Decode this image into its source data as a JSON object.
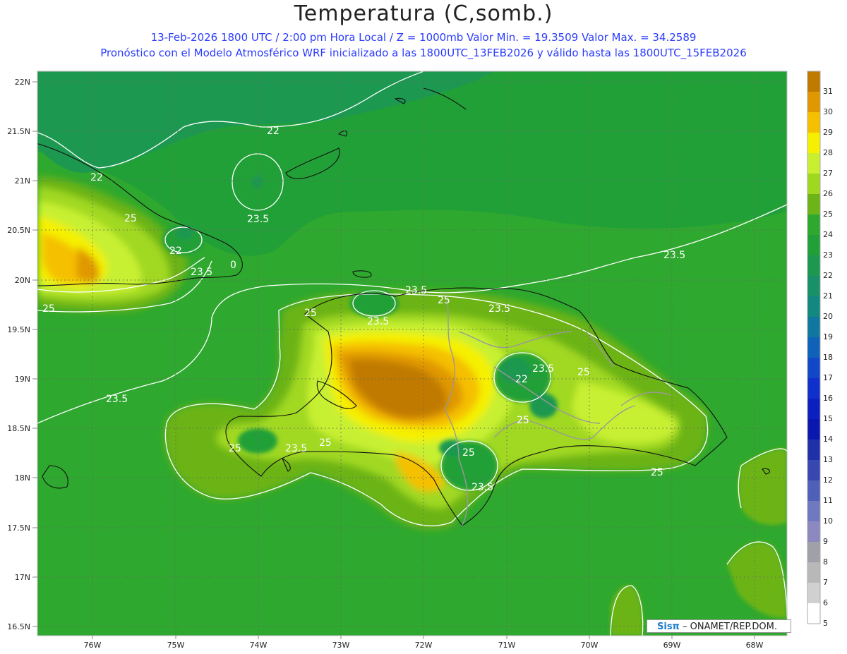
{
  "title": "Temperatura (C,somb.)",
  "subtitle_line1": "13-Feb-2026  1800 UTC / 2:00 pm Hora Local / Z = 1000mb   Valor Min. = 19.3509  Valor Max. = 34.2589",
  "subtitle_line2": "Pronóstico con el Modelo Atmosférico WRF inicializado a las 1800UTC_13FEB2026 y válido hasta las  1800UTC_15FEB2026",
  "lat_labels": [
    "22N",
    "21.5N",
    "21N",
    "20.5N",
    "20N",
    "19.5N",
    "19N",
    "18.5N",
    "18N",
    "17.5N",
    "17N",
    "16.5N"
  ],
  "lon_labels": [
    "76W",
    "75W",
    "74W",
    "73W",
    "72W",
    "71W",
    "70W",
    "69W",
    "68W"
  ],
  "contour_labels": [
    "22",
    "22",
    "22",
    "23.5",
    "23.5",
    "23.5",
    "23.5",
    "23.5",
    "23.5",
    "23.5",
    "23.5",
    "25",
    "25",
    "25",
    "25",
    "25",
    "25",
    "25",
    "25",
    "25",
    "25",
    "0"
  ],
  "colorbar": {
    "labels": [
      "31",
      "30",
      "29",
      "28",
      "27",
      "26",
      "25",
      "24",
      "23",
      "22",
      "21",
      "20",
      "19",
      "18",
      "17",
      "16",
      "15",
      "14",
      "13",
      "12",
      "11",
      "10",
      "9",
      "8",
      "7",
      "6",
      "5"
    ],
    "colors": [
      "#c07a00",
      "#e09800",
      "#f5c000",
      "#f5f000",
      "#c8f030",
      "#a0d820",
      "#6cb418",
      "#2ea82e",
      "#22a038",
      "#1c9850",
      "#189068",
      "#128880",
      "#1078a0",
      "#1062b8",
      "#1048c8",
      "#1030cc",
      "#0c20c0",
      "#0a18b0",
      "#2030a8",
      "#3848b0",
      "#5060b8",
      "#7078c0",
      "#8c88c0",
      "#a0a0a8",
      "#b8b8b8",
      "#d0d0d0",
      "#ffffff"
    ]
  },
  "credit": {
    "logo": "Sisπ",
    "org": "–  ONAMET/REP.DOM."
  }
}
